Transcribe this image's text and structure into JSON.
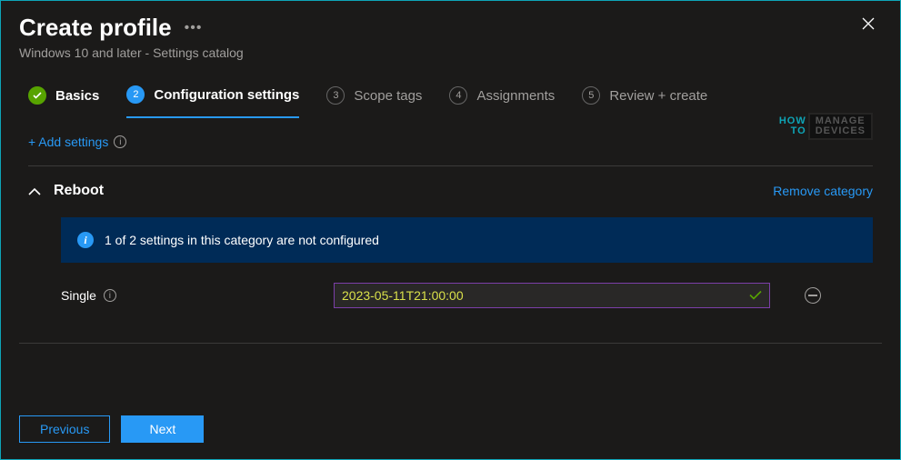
{
  "header": {
    "title": "Create profile",
    "subtitle": "Windows 10 and later - Settings catalog"
  },
  "wizard": {
    "steps": [
      {
        "num": "✓",
        "label": "Basics",
        "state": "done"
      },
      {
        "num": "2",
        "label": "Configuration settings",
        "state": "active"
      },
      {
        "num": "3",
        "label": "Scope tags",
        "state": "upcoming"
      },
      {
        "num": "4",
        "label": "Assignments",
        "state": "upcoming"
      },
      {
        "num": "5",
        "label": "Review + create",
        "state": "upcoming"
      }
    ]
  },
  "toolbar": {
    "add_settings_label": "+ Add settings"
  },
  "watermark": {
    "line1": "HOW",
    "line2": "TO",
    "box1": "MANAGE",
    "box2": "DEVICES"
  },
  "category": {
    "name": "Reboot",
    "remove_label": "Remove category",
    "banner_text": "1 of 2 settings in this category are not configured",
    "settings": [
      {
        "label": "Single",
        "value": "2023-05-11T21:00:00"
      }
    ]
  },
  "footer": {
    "previous_label": "Previous",
    "next_label": "Next"
  }
}
